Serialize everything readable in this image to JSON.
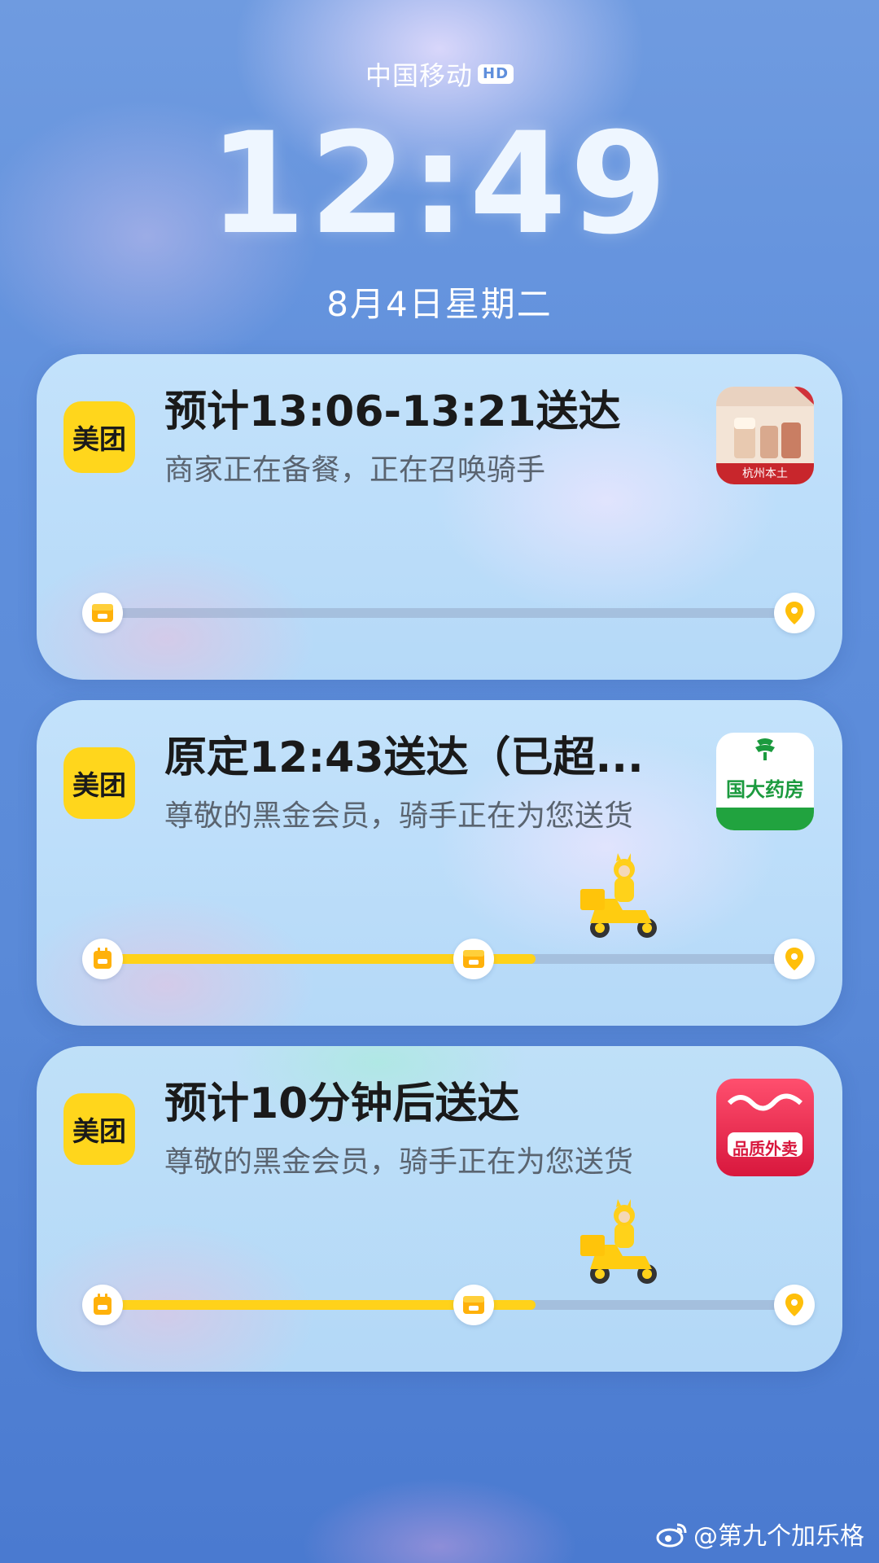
{
  "status_bar": {
    "carrier": "中国移动",
    "network_badge": "HD"
  },
  "lockscreen": {
    "time": "12:49",
    "date": "8月4日星期二"
  },
  "notifications": [
    {
      "app_icon_label": "美团",
      "title": "预计13:06-13:21送达",
      "subtitle": "商家正在备餐，正在召唤骑手",
      "store_icon": "store-milk-tea-icon",
      "store_caption": "杭州本土",
      "progress": 0.0,
      "progress_stage": "preparing"
    },
    {
      "app_icon_label": "美团",
      "title": "原定12:43送达（已超...",
      "subtitle": "尊敬的黑金会员，骑手正在为您送货",
      "store_icon": "store-pharmacy-icon",
      "store_caption": "国大药房",
      "progress": 0.62,
      "progress_stage": "delivering"
    },
    {
      "app_icon_label": "美团",
      "title": "预计10分钟后送达",
      "subtitle": "尊敬的黑金会员，骑手正在为您送货",
      "store_icon": "store-restaurant-icon",
      "store_caption": "品质外卖",
      "progress": 0.62,
      "progress_stage": "delivering"
    }
  ],
  "watermark": "@第九个加乐格",
  "colors": {
    "meituan_yellow": "#ffd61c",
    "progress_fill": "#ffd21a",
    "card_bg": "#c3e2fb"
  }
}
